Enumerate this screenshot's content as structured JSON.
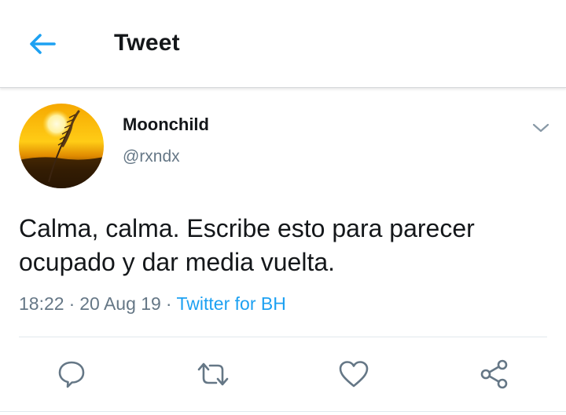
{
  "header": {
    "title": "Tweet",
    "back_icon": "arrow-left-icon"
  },
  "tweet": {
    "author": {
      "display_name": "Moonchild",
      "handle": "@rxndx"
    },
    "text": "Calma, calma. Escribe esto para parecer ocupado y dar media vuelta.",
    "time": "18:22",
    "separator": "·",
    "date": "20 Aug 19",
    "source": "Twitter for BH"
  },
  "actions": {
    "icons": [
      "reply-icon",
      "retweet-icon",
      "like-icon",
      "share-icon"
    ]
  },
  "colors": {
    "accent": "#1da1f2",
    "text": "#14171a",
    "secondary": "#657786",
    "divider": "#e1e8ed"
  }
}
